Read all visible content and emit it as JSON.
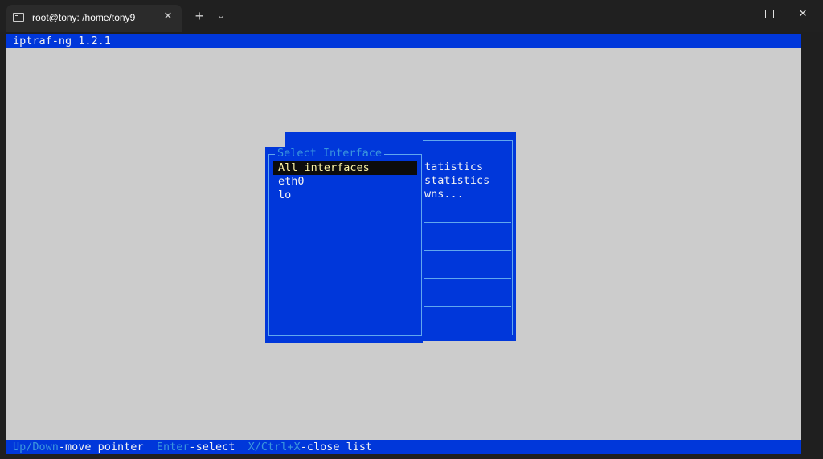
{
  "window": {
    "tab_title": "root@tony: /home/tony9",
    "tab_close": "✕",
    "new_tab": "+",
    "dropdown": "⌄",
    "close": "✕"
  },
  "terminal": {
    "header": "iptraf-ng 1.2.1",
    "background_menu_items": [
      "tatistics",
      "statistics",
      "wns..."
    ],
    "select_dialog": {
      "title": "Select Interface",
      "items": [
        "All interfaces",
        "eth0",
        "lo"
      ],
      "selected_index": 0
    },
    "status_bar": {
      "key1": "Up/Down",
      "desc1": "-move pointer",
      "key2": "Enter",
      "desc2": "-select",
      "key3": "X/Ctrl+X",
      "desc3": "-close list"
    }
  },
  "colors": {
    "terminal_bg": "#cccccc",
    "panel_blue": "#0037da",
    "accent_cyan": "#3a96dd",
    "highlight_bg": "#0c0c0c",
    "highlight_text": "#f9f1a5"
  }
}
